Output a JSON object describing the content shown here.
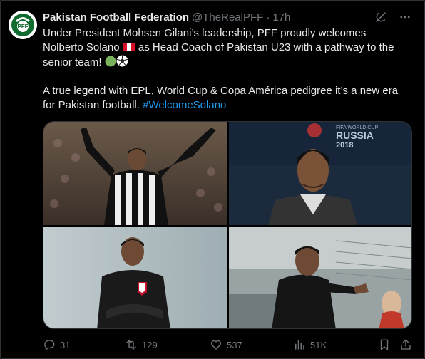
{
  "tweet": {
    "author_name": "Pakistan Football Federation",
    "handle": "@TheRealPFF",
    "separator": "·",
    "time": "17h",
    "avatar_text": "PFF",
    "line1_a": "Under President Mohsen Gilani’s leadership, PFF proudly welcomes",
    "line2_a": "Nolberto Solano",
    "line2_b": "as Head Coach of Pakistan U23 with a pathway to the",
    "line3_a": "senior team!",
    "line4": "A true legend with EPL, World Cup & Copa América pedigree it’s a new era",
    "line5_a": "for Pakistan football.",
    "hashtag": "#WelcomeSolano"
  },
  "photos": {
    "p2_banner_top": "FIFA WORLD CUP",
    "p2_banner_main": "RUSSIA",
    "p2_banner_year": "2018"
  },
  "actions": {
    "replies": "31",
    "reposts": "129",
    "likes": "537",
    "views": "51K"
  },
  "colors": {
    "accent": "#1d9bf0",
    "muted": "#71767b",
    "text": "#e7e9ea",
    "bg": "#000000",
    "border": "#2f3336"
  }
}
